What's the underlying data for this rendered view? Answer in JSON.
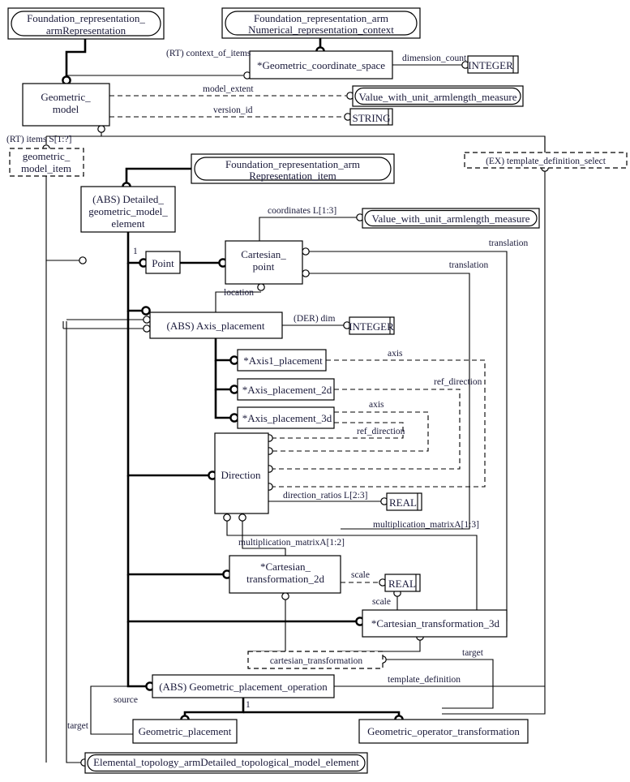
{
  "diagram": {
    "kind": "EXPRESS-G entity-level schema diagram",
    "title_shown": false,
    "colors": {
      "line": "#000000",
      "text": "#1a1a3a",
      "background": "#ffffff"
    }
  },
  "entities": {
    "foundation_representation": "Foundation_representation_\narmRepresentation",
    "foundation_representation_l1": "Foundation_representation_",
    "foundation_representation_l2": "armRepresentation",
    "numerical_context_l1": "Foundation_representation_arm",
    "numerical_context_l2": "Numerical_representation_context",
    "representation_item_l1": "Foundation_representation_arm",
    "representation_item_l2": "Representation_item",
    "geometric_coordinate_space": "*Geometric_coordinate_space",
    "geometric_model_l1": "Geometric_",
    "geometric_model_l2": "model",
    "geometric_model_item_l1": "geometric_",
    "geometric_model_item_l2": "model_item",
    "detailed_gme_l1": "(ABS) Detailed_",
    "detailed_gme_l2": "geometric_model_",
    "detailed_gme_l3": "element",
    "point": "Point",
    "cartesian_point_l1": "Cartesian_",
    "cartesian_point_l2": "point",
    "axis_placement": "(ABS) Axis_placement",
    "axis1_placement": "*Axis1_placement",
    "axis_placement_2d": "*Axis_placement_2d",
    "axis_placement_3d": "*Axis_placement_3d",
    "direction": "Direction",
    "cartesian_transformation_2d_l1": "*Cartesian_",
    "cartesian_transformation_2d_l2": "transformation_2d",
    "cartesian_transformation_3d": "*Cartesian_transformation_3d",
    "cartesian_transformation_select": "cartesian_transformation",
    "geometric_placement_operation": "(ABS) Geometric_placement_operation",
    "geometric_placement": "Geometric_placement",
    "geometric_operator_transformation": "Geometric_operator_transformation",
    "elemental_topology": "Elemental_topology_armDetailed_topological_model_element",
    "template_definition_select": "(EX) template_definition_select",
    "value_with_unit_measure_1": "Value_with_unit_armlength_measure",
    "value_with_unit_measure_2": "Value_with_unit_armlength_measure",
    "integer_1": "INTEGER",
    "integer_2": "INTEGER",
    "string_1": "STRING",
    "real_1": "REAL",
    "real_2": "REAL"
  },
  "attribute_labels": {
    "context_of_items": "(RT) context_of_items",
    "model_extent": "model_extent",
    "version_id": "version_id",
    "items": "(RT) items S[1:?]",
    "dimension_count": "dimension_count",
    "coordinates": "coordinates L[1:3]",
    "translation_1": "translation",
    "translation_2": "translation",
    "location": "location",
    "dim": "(DER) dim",
    "axis_1": "axis",
    "ref_direction_1": "ref_direction",
    "axis_2": "axis",
    "ref_direction_2": "ref_direction",
    "direction_ratios": "direction_ratios L[2:3]",
    "multiplication_matrix_13": "multiplication_matrixA[1:3]",
    "multiplication_matrix_12": "multiplication_matrixA[1:2]",
    "scale_1": "scale",
    "scale_2": "scale",
    "source": "source",
    "target_1": "target",
    "target_2": "target",
    "template_definition": "template_definition",
    "cardinality_one_1": "1",
    "cardinality_one_2": "1"
  }
}
